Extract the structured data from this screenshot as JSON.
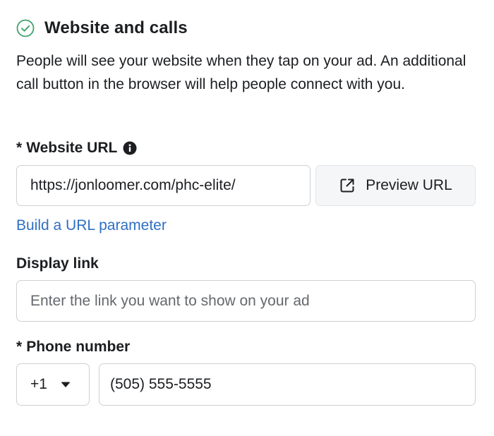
{
  "section": {
    "title": "Website and calls",
    "description": "People will see your website when they tap on your ad. An additional call button in the browser will help people connect with you.",
    "status_icon": "check-circle-icon"
  },
  "website_url": {
    "required_mark": "*",
    "label": "Website URL",
    "info_icon": "info-icon",
    "value": "https://jonloomer.com/phc-elite/",
    "preview_button_label": "Preview URL",
    "preview_icon": "external-link-icon",
    "build_param_link": "Build a URL parameter"
  },
  "display_link": {
    "label": "Display link",
    "placeholder": "Enter the link you want to show on your ad",
    "value": ""
  },
  "phone_number": {
    "required_mark": "*",
    "label": "Phone number",
    "country_code": "+1",
    "value": "(505) 555-5555"
  },
  "colors": {
    "text": "#1c1e21",
    "link": "#2f6fc2",
    "success_icon": "#3ea36b",
    "border": "#cdd0d4",
    "button_bg": "#f5f6f7"
  }
}
